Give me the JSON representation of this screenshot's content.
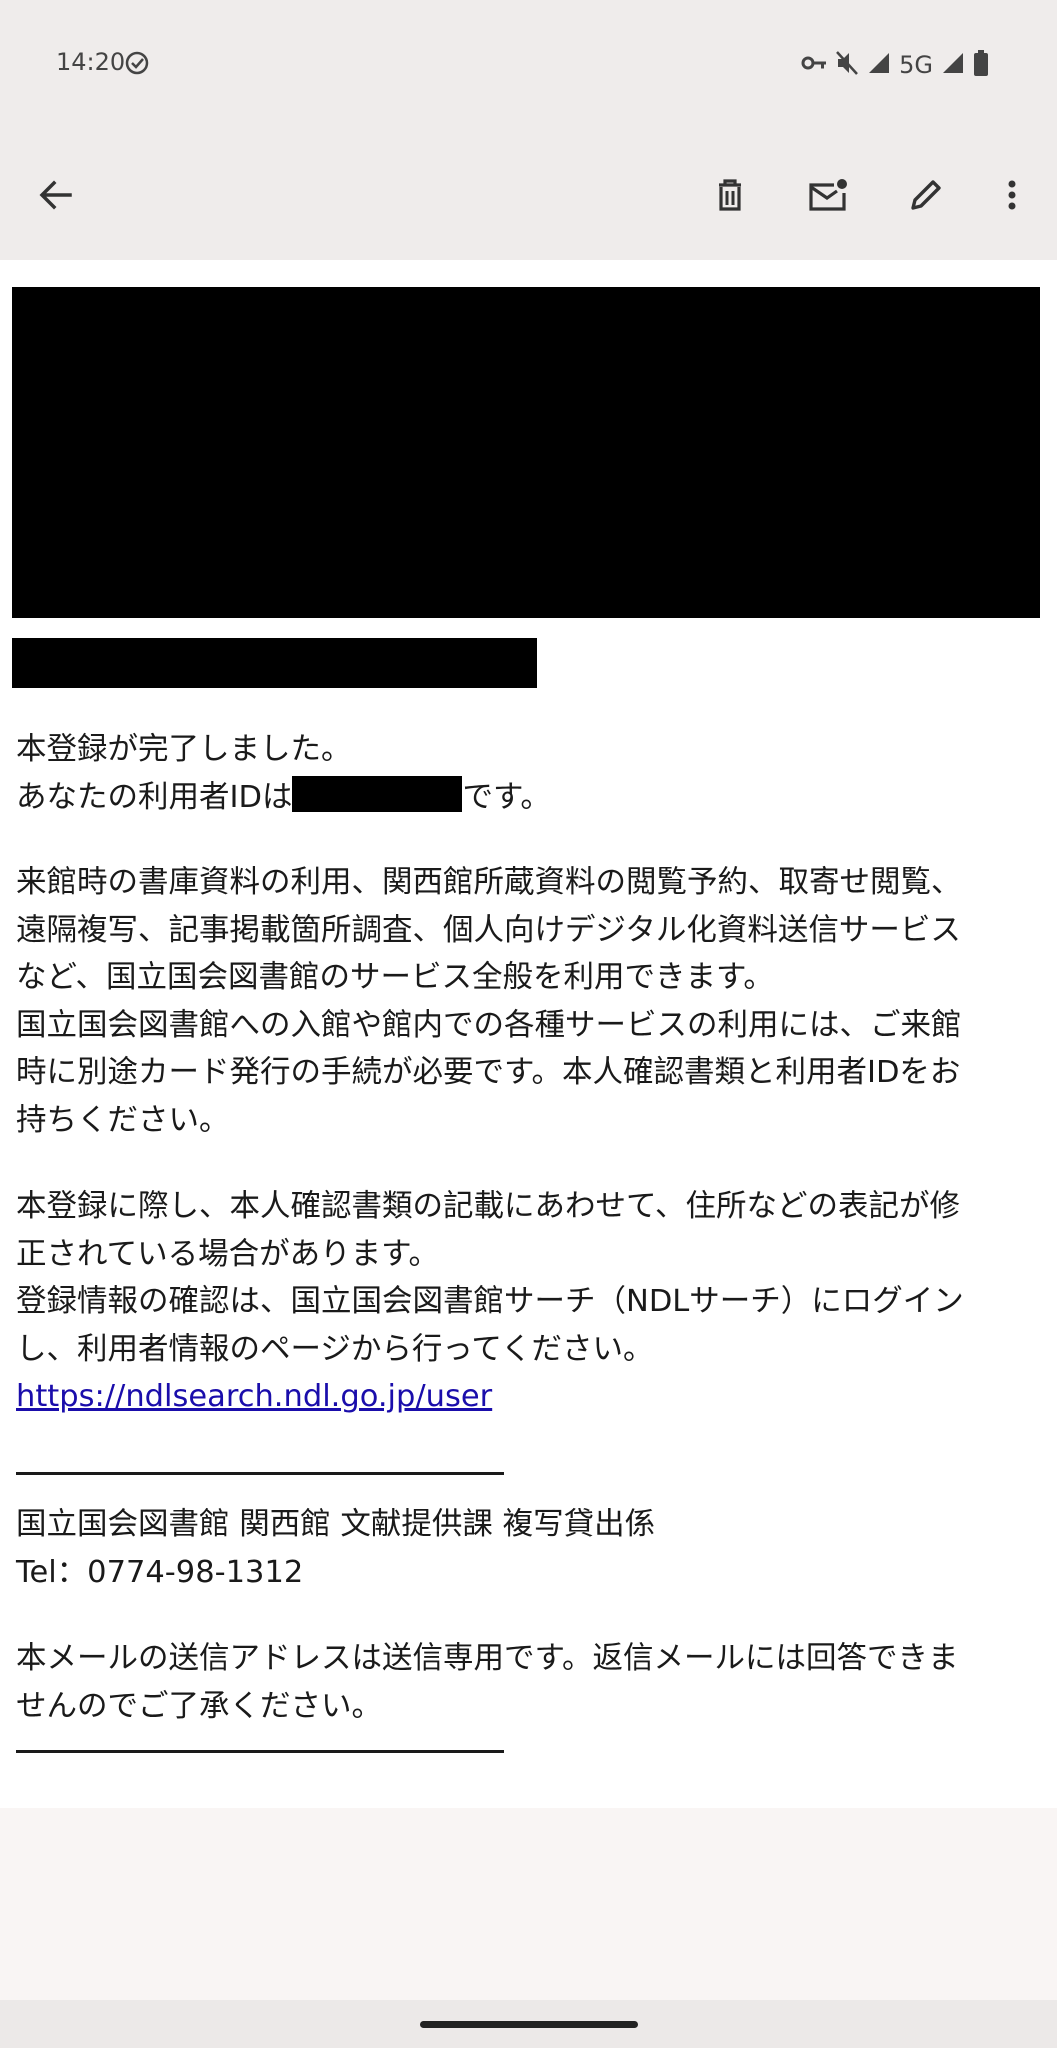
{
  "status_bar": {
    "time": "14:20",
    "network": "5G",
    "icons": [
      "done-circle-icon",
      "vpn-key-icon",
      "mute-icon",
      "signal-icon",
      "signal-icon",
      "battery-icon"
    ]
  },
  "toolbar": {
    "icons": [
      "back-arrow-icon",
      "delete-icon",
      "mark-unread-icon",
      "edit-icon",
      "more-vert-icon"
    ]
  },
  "email": {
    "line_complete": "本登録が完了しました。",
    "id_prefix": "あなたの利用者IDは",
    "id_suffix": "です。",
    "para1": "来館時の書庫資料の利用、関西館所蔵資料の閲覧予約、取寄せ閲覧、\n遠隔複写、記事掲載箇所調査、個人向けデジタル化資料送信サービス\nなど、国立国会図書館のサービス全般を利用できます。\n国立国会図書館への入館や館内での各種サービスの利用には、ご来館\n時に別途カード発行の手続が必要です。本人確認書類と利用者IDをお\n持ちください。",
    "para2": "本登録に際し、本人確認書類の記載にあわせて、住所などの表記が修\n正されている場合があります。\n登録情報の確認は、国立国会図書館サーチ（NDLサーチ）にログイン\nし、利用者情報のページから行ってください。",
    "link": "https://ndlsearch.ndl.go.jp/user",
    "signature_org": "国立国会図書館 関西館 文献提供課 複写貸出係",
    "signature_tel": "Tel：0774-98-1312",
    "notice": "本メールの送信アドレスは送信専用です。返信メールには回答できま\nせんのでご了承ください。"
  }
}
